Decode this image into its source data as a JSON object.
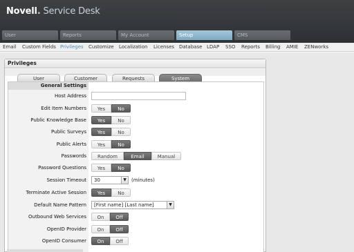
{
  "app": {
    "brand": "Novell",
    "dot": ".",
    "product": " Service Desk"
  },
  "main_tabs": [
    {
      "label": "User"
    },
    {
      "label": "Reports"
    },
    {
      "label": "My Account"
    },
    {
      "label": "Setup"
    },
    {
      "label": "CMS"
    }
  ],
  "sub_nav": [
    "Email",
    "Custom Fields",
    "Privileges",
    "Customize",
    "Localization",
    "Licenses",
    "Database",
    "LDAP",
    "SSO",
    "Reports",
    "Billing",
    "AMIE",
    "ZENworks"
  ],
  "panel": {
    "title": "Privileges",
    "tabs": [
      "User",
      "Customer",
      "Requests",
      "System"
    ],
    "section": "General Settings"
  },
  "fields": {
    "host_address": {
      "label": "Host Address",
      "value": ""
    },
    "edit_item_numbers": {
      "label": "Edit Item Numbers",
      "options": [
        "Yes",
        "No"
      ],
      "selected": "No"
    },
    "public_kb": {
      "label": "Public Knowledge Base",
      "options": [
        "Yes",
        "No"
      ],
      "selected": "Yes"
    },
    "public_surveys": {
      "label": "Public Surveys",
      "options": [
        "Yes",
        "No"
      ],
      "selected": "Yes"
    },
    "public_alerts": {
      "label": "Public Alerts",
      "options": [
        "Yes",
        "No"
      ],
      "selected": "No"
    },
    "passwords": {
      "label": "Passwords",
      "options": [
        "Random",
        "Email",
        "Manual"
      ],
      "selected": "Email"
    },
    "password_questions": {
      "label": "Password Questions",
      "options": [
        "Yes",
        "No"
      ],
      "selected": "No"
    },
    "session_timeout": {
      "label": "Session Timeout",
      "value": "30",
      "unit": "(minutes)"
    },
    "terminate_active": {
      "label": "Terminate Active Session",
      "options": [
        "Yes",
        "No"
      ],
      "selected": "Yes"
    },
    "default_name_pattern": {
      "label": "Default Name Pattern",
      "value": "[First name] [Last name]"
    },
    "outbound_ws": {
      "label": "Outbound Web Services",
      "options": [
        "On",
        "Off"
      ],
      "selected": "Off"
    },
    "openid_provider": {
      "label": "OpenID Provider",
      "options": [
        "On",
        "Off"
      ],
      "selected": "Off"
    },
    "openid_consumer": {
      "label": "OpenID Consumer",
      "options": [
        "On",
        "Off"
      ],
      "selected": "On"
    }
  },
  "colors": {
    "topbar": "#35383a",
    "active_tab": "#8db6cd",
    "active_subnav": "#4d8fb5",
    "toggle_on": "#666666"
  },
  "icons": {
    "dropdown": "chevron-down-icon"
  }
}
